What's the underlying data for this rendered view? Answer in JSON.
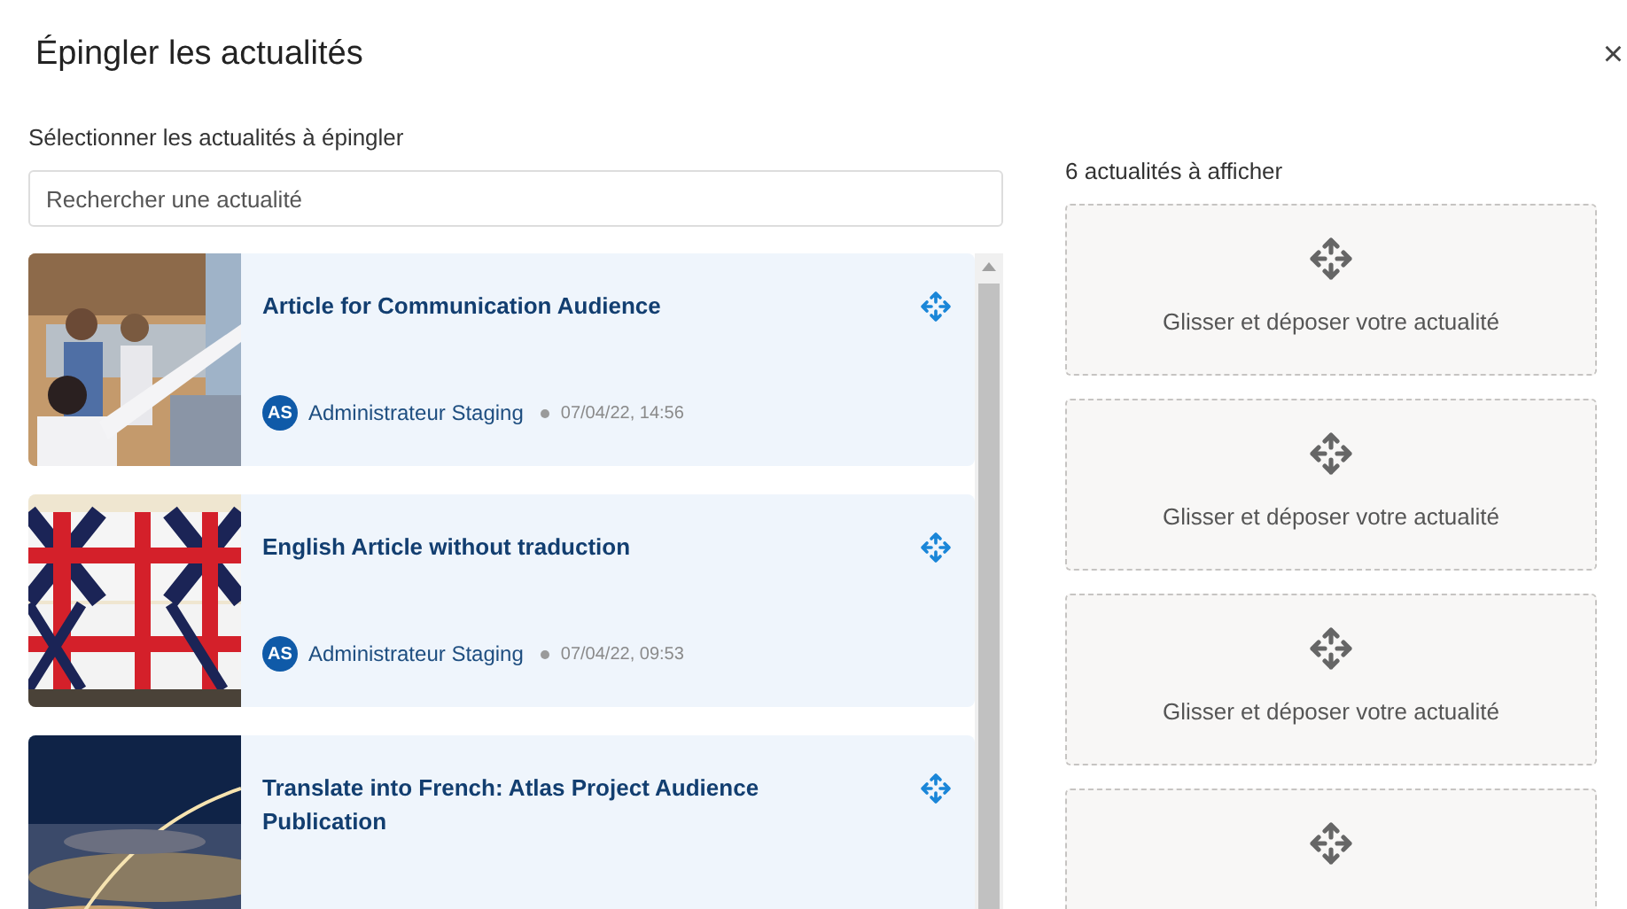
{
  "dialog": {
    "title": "Épingler les actualités",
    "close": "×"
  },
  "left": {
    "label": "Sélectionner les actualités à épingler",
    "search": {
      "placeholder": "Rechercher une actualité"
    },
    "articles": [
      {
        "title": "Article for Communication Audience",
        "initials": "AS",
        "author": "Administrateur Staging",
        "date": "07/04/22, 14:56"
      },
      {
        "title": "English Article without traduction",
        "initials": "AS",
        "author": "Administrateur Staging",
        "date": "07/04/22, 09:53"
      },
      {
        "title": "Translate into French: Atlas Project Audience Publication"
      }
    ]
  },
  "right": {
    "label": "6 actualités à afficher",
    "slots": [
      {
        "kind": "text",
        "hint": "Glisser et déposer votre actualité"
      },
      {
        "kind": "text",
        "hint": "Glisser et déposer votre actualité"
      },
      {
        "kind": "text",
        "hint": "Glisser et déposer votre actualité"
      },
      {
        "kind": "icon"
      }
    ]
  }
}
